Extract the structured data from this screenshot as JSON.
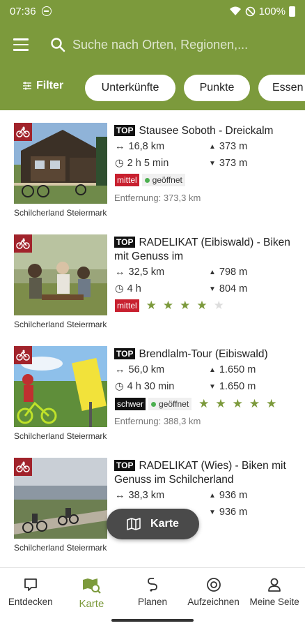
{
  "status": {
    "time": "07:36",
    "battery": "100%"
  },
  "search": {
    "placeholder": "Suche nach Orten, Regionen,..."
  },
  "filters": {
    "filter_label": "Filter",
    "chips": [
      "Unterkünfte",
      "Punkte",
      "Essen"
    ]
  },
  "tours": [
    {
      "top": "TOP",
      "title": "Stausee Soboth - Dreickalm",
      "distance": "16,8 km",
      "duration": "2 h 5 min",
      "ascent": "373 m",
      "descent": "373 m",
      "difficulty": "mittel",
      "status": "geöffnet",
      "rating": null,
      "away": "Entfernung: 373,3 km",
      "region": "Schilcherland Steiermark"
    },
    {
      "top": "TOP",
      "title": "RADELIKAT (Eibiswald) - Biken mit Genuss im",
      "distance": "32,5 km",
      "duration": "4 h",
      "ascent": "798 m",
      "descent": "804 m",
      "difficulty": "mittel",
      "status": null,
      "rating": 4,
      "away": null,
      "region": "Schilcherland Steiermark"
    },
    {
      "top": "TOP",
      "title": "Brendlalm-Tour (Eibiswald)",
      "distance": "56,0 km",
      "duration": "4 h 30 min",
      "ascent": "1.650 m",
      "descent": "1.650 m",
      "difficulty": "schwer",
      "status": "geöffnet",
      "rating": 5,
      "away": "Entfernung: 388,3 km",
      "region": "Schilcherland Steiermark"
    },
    {
      "top": "TOP",
      "title": "RADELIKAT (Wies) - Biken mit Genuss im Schilcherland",
      "distance": "38,3 km",
      "duration": "",
      "ascent": "936 m",
      "descent": "936 m",
      "difficulty": null,
      "status": null,
      "rating": null,
      "away": null,
      "region": "Schilcherland Steiermark"
    }
  ],
  "fab": {
    "label": "Karte"
  },
  "nav": [
    "Entdecken",
    "Karte",
    "Planen",
    "Aufzeichnen",
    "Meine Seite"
  ],
  "colors": {
    "brand": "#7c9a3c",
    "difficulty_medium": "#c8202f",
    "difficulty_hard": "#111111",
    "bike_badge": "#a1232b"
  }
}
